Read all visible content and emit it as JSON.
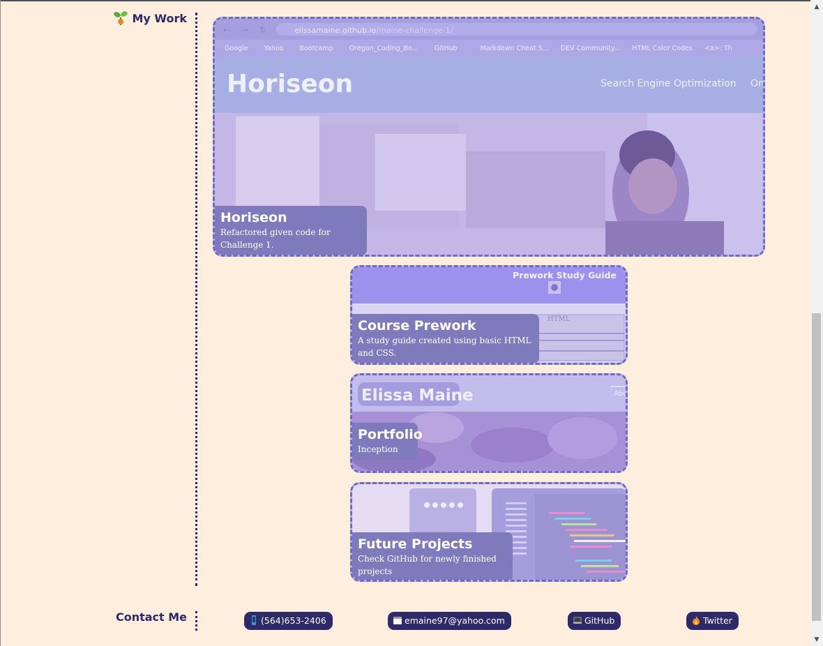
{
  "sections": {
    "work": {
      "title": "My Work",
      "icon": "seedling-icon"
    },
    "contact": {
      "title": "Contact Me"
    }
  },
  "projects": [
    {
      "title": "Horiseon",
      "description": "Refactored given code for Challenge 1.",
      "screenshot": {
        "url_host": "elissamaine.github.io",
        "url_path": "/maine-challenge-1/",
        "bookmarks": [
          "Google",
          "Yahoo",
          "Bootcamp",
          "Oregon_Coding_Bo...",
          "GitHub",
          "Markdown Cheat S...",
          "DEV Community...",
          "HTML Color Codes",
          "<a>: Th"
        ],
        "site_title": "Horiseon",
        "nav_item": "Search Engine Optimization",
        "nav_item_cut": "Onli"
      }
    },
    {
      "title": "Course Prework",
      "description": "A study guide created using basic HTML and CSS.",
      "screenshot": {
        "site_title": "Prework Study Guide",
        "section": "HTML"
      }
    },
    {
      "title": "Portfolio",
      "description": "Inception",
      "screenshot": {
        "site_title": "Elissa Maine",
        "nav_item_cut": "Abc"
      }
    },
    {
      "title": "Future Projects",
      "description": "Check GitHub for newly finished projects"
    }
  ],
  "contacts": [
    {
      "label": "(564)653-2406",
      "icon": "phone-icon"
    },
    {
      "label": "emaine97@yahoo.com",
      "icon": "calendar-icon"
    },
    {
      "label": "GitHub",
      "icon": "laptop-icon"
    },
    {
      "label": "Twitter",
      "icon": "fire-icon"
    }
  ],
  "colors": {
    "background": "#fdeedd",
    "accent": "#2e2a6a",
    "card_border": "#6e6bbd",
    "caption_bg": "#7e7abb"
  }
}
